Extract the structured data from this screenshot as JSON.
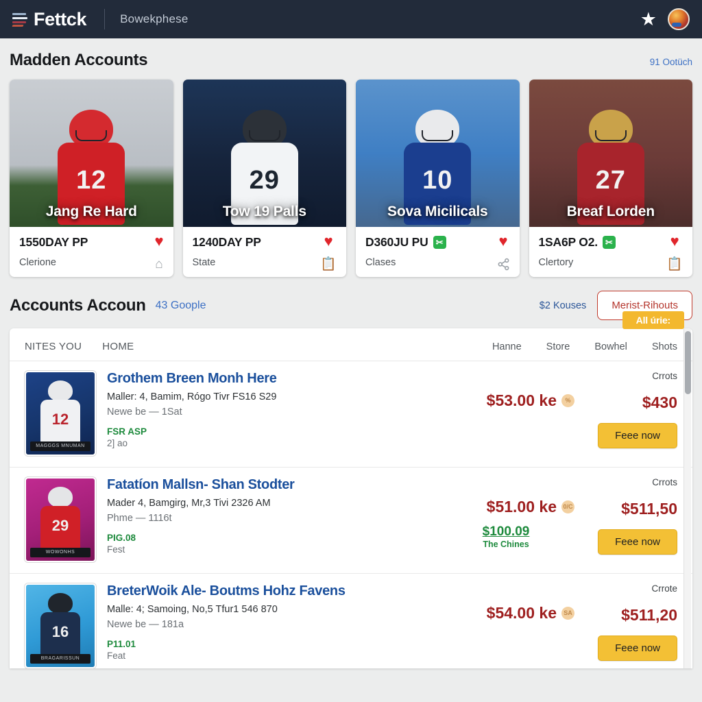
{
  "header": {
    "brand": "Fettck",
    "section": "Bowekphese",
    "star_icon": "star-icon",
    "avatar_icon": "avatar"
  },
  "featured": {
    "title": "Madden Accounts",
    "link": "91 Ootüch",
    "cards": [
      {
        "name": "Jang Re Hard",
        "line1": "1550DAY PP",
        "line2": "Clerione",
        "badge": false,
        "icon1": "heart-icon",
        "icon2": "home-icon",
        "icon2_glyph": "⌂",
        "photo_sky": "#c9cdd2",
        "photo_ground": "#3d5f35",
        "jersey": "#cf2026",
        "helmet": "#d42a2f",
        "number": "12"
      },
      {
        "name": "Tow 19 Palls",
        "line1": "1240DAY PP",
        "line2": "State",
        "badge": false,
        "icon1": "heart-icon",
        "icon2": "clipboard-icon",
        "icon2_glyph": "📋",
        "photo_sky": "#16243c",
        "photo_ground": "#1b2a3f",
        "jersey": "#f2f4f6",
        "helmet": "#2c3138",
        "number": "29"
      },
      {
        "name": "Sova Micilicals",
        "line1": "D360JU PU",
        "line2": "Clases",
        "badge": true,
        "icon1": "heart-icon",
        "icon2": "share-icon",
        "icon2_glyph": "⤴",
        "photo_sky": "#3f7fc4",
        "photo_ground": "#4a6fa3",
        "jersey": "#1b3e8f",
        "helmet": "#e9eaec",
        "number": "10"
      },
      {
        "name": "Breaf Lorden",
        "line1": "1SA6P O2.",
        "line2": "Clertory",
        "badge": true,
        "icon1": "heart-icon",
        "icon2": "clipboard-icon",
        "icon2_glyph": "📋",
        "photo_sky": "#6b3b38",
        "photo_ground": "#55332f",
        "jersey": "#a8242c",
        "helmet": "#c9a24a",
        "number": "27"
      }
    ]
  },
  "listing": {
    "title": "Accounts Accoun",
    "title_link": "43 Goople",
    "kouses": "$2 Kouses",
    "filter_button": "Merist-Rihouts",
    "yellow_badge": "All úrie:",
    "columns_left": [
      "NITES YOU",
      "HOME"
    ],
    "columns_right": [
      "Hanne",
      "Store",
      "Bowhel",
      "Shots"
    ],
    "rows": [
      {
        "title": "Grothem Breen Monh Here",
        "sub1": "Maller: 4, Bamim, Rógo Tivr FS16 S29",
        "sub2": "Newe be — 1Sat",
        "ship": "FSR ASP",
        "ship2": "2] ao",
        "price": "$53.00 ke",
        "coin": "%",
        "price_green": "",
        "price_green_sub": "",
        "crrots": "Crrots",
        "price_alt": "$430",
        "buy": "Feee now",
        "thumb_bg": "#16356b",
        "thumb_jersey": "#f0f1f3",
        "thumb_helmet": "#e8e9eb",
        "thumb_num": "12",
        "thumb_caption": "MAGGGS MNUMAN"
      },
      {
        "title": "Fatatíon Mallsn- Shan Stodter",
        "sub1": "Mader 4, Bamgirg, Mr,3 Tivi 2326 AM",
        "sub2": "Phme — 1116t",
        "ship": "PIG.08",
        "ship2": "Fest",
        "price": "$51.00 ke",
        "coin": "0/C",
        "price_green": "$100.09",
        "price_green_sub": "The Chines",
        "crrots": "Crrots",
        "price_alt": "$511,50",
        "buy": "Feee now",
        "thumb_bg": "#a31f78",
        "thumb_jersey": "#d02027",
        "thumb_helmet": "#e4e5e7",
        "thumb_num": "29",
        "thumb_caption": "WOWONHS"
      },
      {
        "title": "BreterWoik Ale- Boutms Hohz Favens",
        "sub1": "Malle: 4; Samoing, No,5 Tfur1 546 870",
        "sub2": "Newe be — 181a",
        "ship": "P11.01",
        "ship2": "Feat",
        "price": "$54.00 ke",
        "coin": "SA",
        "price_green": "",
        "price_green_sub": "",
        "crrots": "Crrote",
        "price_alt": "$511,20",
        "buy": "Feee now",
        "thumb_bg": "#2f9ad6",
        "thumb_jersey": "#1d2f4d",
        "thumb_helmet": "#20252c",
        "thumb_num": "16",
        "thumb_caption": "BRAGARISSUN"
      }
    ]
  },
  "scrollbar": {
    "name": "vertical-scrollbar"
  }
}
